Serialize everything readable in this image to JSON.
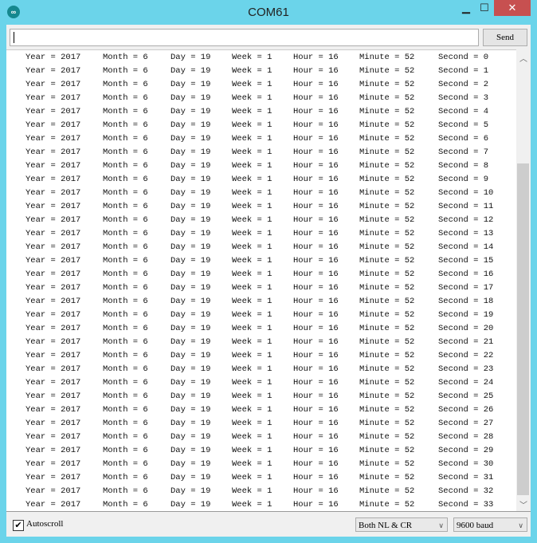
{
  "window": {
    "title": "COM61",
    "minimize": "▁",
    "maximize": "☐",
    "close": "✕",
    "logo_icon": "arduino-logo"
  },
  "toolbar": {
    "input_value": "",
    "send_label": "Send"
  },
  "columns": [
    "Year = 2017",
    "Month = 6",
    "Day = 19",
    "Week = 1",
    "Hour = 16",
    "Minute = 52"
  ],
  "seconds": [
    "0",
    "1",
    "2",
    "3",
    "4",
    "5",
    "6",
    "7",
    "8",
    "9",
    "10",
    "11",
    "12",
    "13",
    "14",
    "15",
    "16",
    "17",
    "18",
    "19",
    "20",
    "21",
    "22",
    "23",
    "24",
    "25",
    "26",
    "27",
    "28",
    "29",
    "30",
    "31",
    "32",
    "33"
  ],
  "second_prefix": "Second = ",
  "footer": {
    "autoscroll_label": "Autoscroll",
    "autoscroll_checked": true,
    "line_ending": "Both NL & CR",
    "baud": "9600 baud"
  },
  "scrollbar": {
    "position_fraction": 0.28,
    "visible_fraction": 0.72
  }
}
